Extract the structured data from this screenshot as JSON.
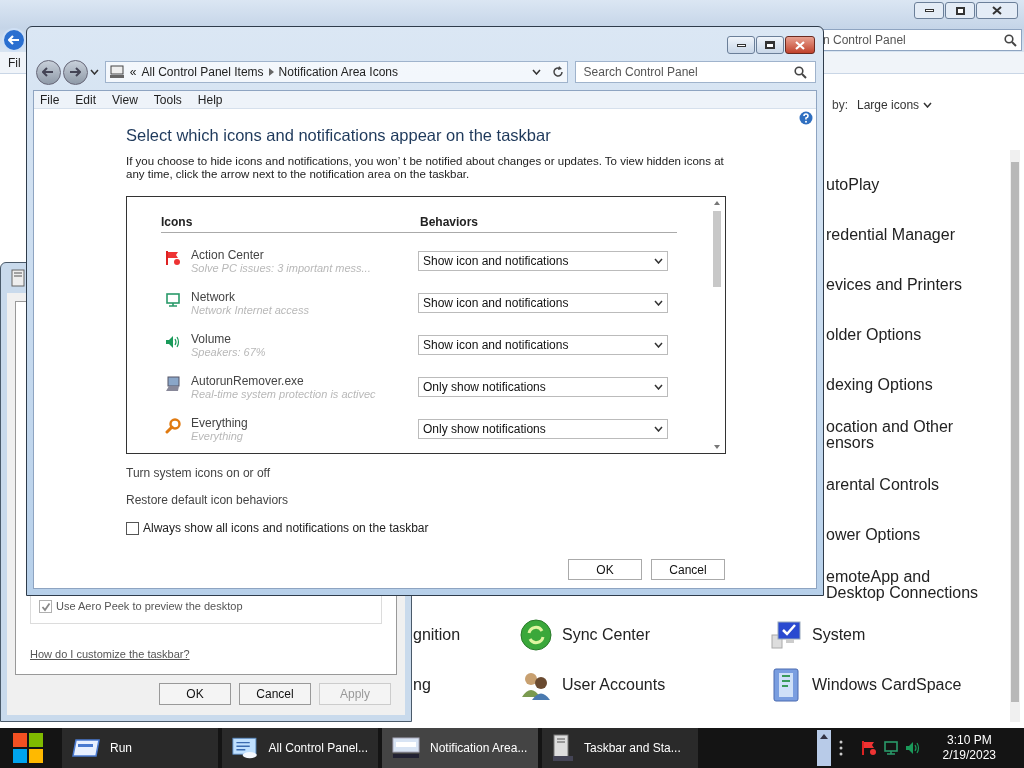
{
  "background_window": {
    "search_placeholder": "n Control Panel",
    "menu": [
      "Fil"
    ],
    "view_by_label": "by:",
    "view_by_value": "Large icons",
    "left_column": [
      {
        "label": "gnition"
      },
      {
        "label": "ng"
      }
    ],
    "middle_column": [
      {
        "label": "Sync Center",
        "kind": "sync"
      },
      {
        "label": "User Accounts",
        "kind": "users"
      }
    ],
    "right_column": [
      {
        "lines": [
          "utoPlay"
        ],
        "kind": "text"
      },
      {
        "lines": [
          "redential Manager"
        ],
        "kind": "text"
      },
      {
        "lines": [
          "evices and Printers"
        ],
        "kind": "text"
      },
      {
        "lines": [
          "older Options"
        ],
        "kind": "text"
      },
      {
        "lines": [
          "dexing Options"
        ],
        "kind": "text"
      },
      {
        "lines": [
          "ocation and Other",
          "ensors"
        ],
        "kind": "text"
      },
      {
        "lines": [
          "arental Controls"
        ],
        "kind": "text"
      },
      {
        "lines": [
          "ower Options"
        ],
        "kind": "text"
      },
      {
        "lines": [
          "emoteApp and",
          "Desktop Connections"
        ],
        "kind": "text"
      },
      {
        "lines": [
          "System"
        ],
        "kind": "system"
      },
      {
        "lines": [
          "Windows CardSpace"
        ],
        "kind": "cardspace"
      }
    ]
  },
  "taskbar_properties": {
    "aero_peek": {
      "label": "Use Aero Peek to preview the desktop",
      "checked": true
    },
    "help_link": "How do I customize the taskbar?",
    "buttons": [
      {
        "label": "OK",
        "disabled": false
      },
      {
        "label": "Cancel",
        "disabled": false
      },
      {
        "label": "Apply",
        "disabled": true
      }
    ]
  },
  "notification_window": {
    "address": {
      "prefix": "«",
      "crumbs": [
        "All Control Panel Items",
        "Notification Area Icons"
      ]
    },
    "search_placeholder": "Search Control Panel",
    "menu": [
      "File",
      "Edit",
      "View",
      "Tools",
      "Help"
    ],
    "heading": "Select which icons and notifications appear on the taskbar",
    "description": "If you choose to hide icons and notifications, you won’ t be notified about changes or updates. To view hidden icons at any time, click the arrow next to the notification area on the taskbar.",
    "columns": [
      "Icons",
      "Behaviors"
    ],
    "rows": [
      {
        "name": "Action Center",
        "detail": "Solve PC issues: 3 important mess...",
        "behavior": "Show icon and notifications",
        "kind": "flag"
      },
      {
        "name": "Network",
        "detail": "Network Internet access",
        "behavior": "Show icon and notifications",
        "kind": "network"
      },
      {
        "name": "Volume",
        "detail": "Speakers: 67%",
        "behavior": "Show icon and notifications",
        "kind": "volume"
      },
      {
        "name": "AutorunRemover.exe",
        "detail": "Real-time system protection is activec",
        "behavior": "Only show notifications",
        "kind": "app"
      },
      {
        "name": "Everything",
        "detail": "Everything",
        "behavior": "Only show notifications",
        "kind": "search"
      }
    ],
    "links": [
      "Turn system icons on or off",
      "Restore default icon behaviors"
    ],
    "always_show": {
      "label": "Always show all icons and notifications on the taskbar",
      "checked": false
    },
    "buttons": [
      "OK",
      "Cancel"
    ]
  },
  "taskbar": {
    "items": [
      {
        "label": "Run",
        "kind": "run",
        "selected": false
      },
      {
        "label": "All Control Panel...",
        "kind": "control-panel",
        "selected": false
      },
      {
        "label": "Notification Area...",
        "kind": "notification",
        "selected": true
      },
      {
        "label": "Taskbar and Sta...",
        "kind": "taskbar",
        "selected": false
      }
    ],
    "clock": {
      "time": "3:10 PM",
      "date": "2/19/2023"
    }
  }
}
